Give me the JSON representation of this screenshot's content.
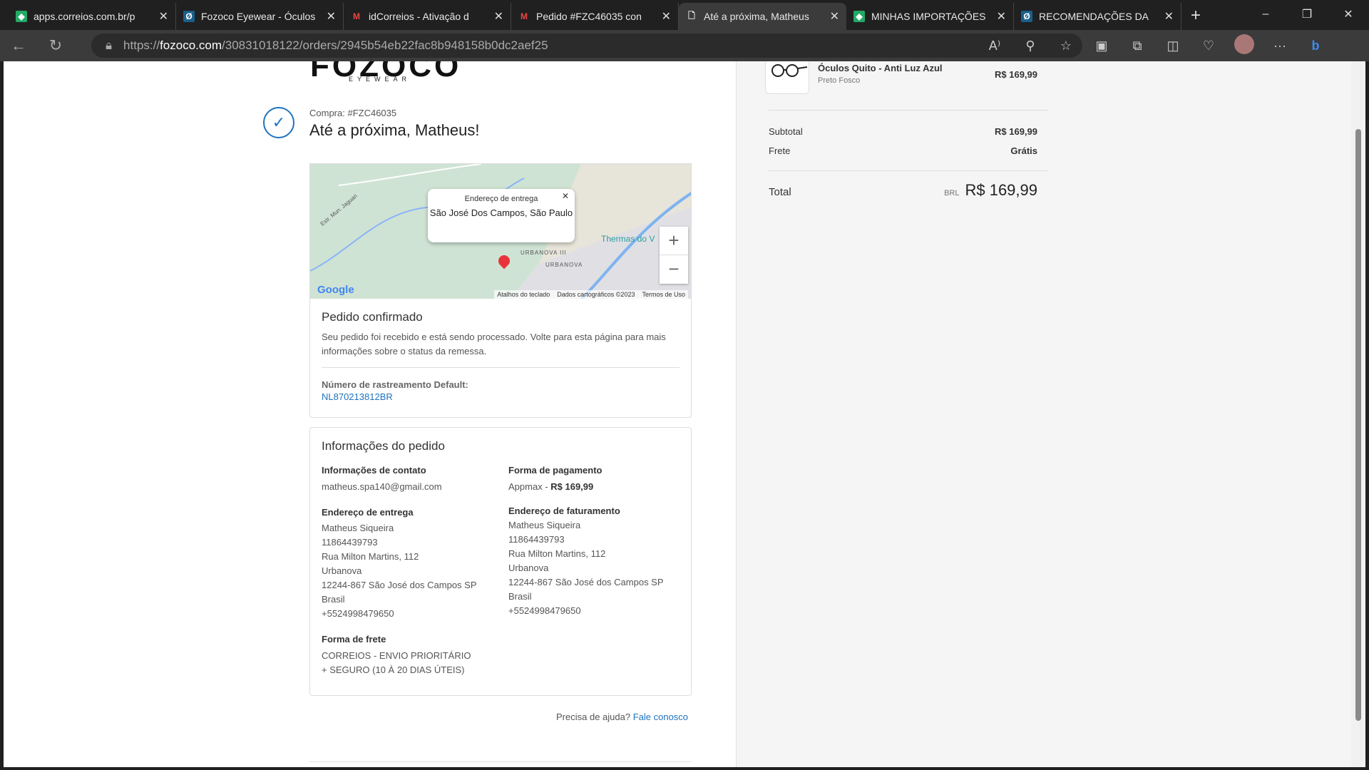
{
  "browser": {
    "tabs": [
      {
        "title": "apps.correios.com.br/p",
        "icon": "correios-icon"
      },
      {
        "title": "Fozoco Eyewear - Óculos",
        "icon": "fozoco-icon"
      },
      {
        "title": "idCorreios - Ativação d",
        "icon": "gmail-icon"
      },
      {
        "title": "Pedido #FZC46035 con",
        "icon": "gmail-icon"
      },
      {
        "title": "Até a próxima, Matheus",
        "icon": "page-icon",
        "active": true
      },
      {
        "title": "MINHAS IMPORTAÇÕES",
        "icon": "correios-icon"
      },
      {
        "title": "RECOMENDAÇÕES DA",
        "icon": "fozoco-icon"
      }
    ],
    "url_prefix": "https://",
    "url_host": "fozoco.com",
    "url_path": "/30831018122/orders/2945b54eb22fac8b948158b0dc2aef25"
  },
  "header": {
    "logo": "FOZOCO",
    "logo_sub": "EYEWEAR",
    "order_label": "Compra: #FZC46035",
    "title": "Até a próxima, Matheus!"
  },
  "map": {
    "popup_label": "Endereço de entrega",
    "popup_value": "São José Dos Campos, São Paulo",
    "labels": [
      "URBANOVA III",
      "URBANOVA",
      "Thermas do V",
      "Estr. Mun. Jaguari"
    ],
    "google": "Google",
    "attribution": [
      "Atalhos do teclado",
      "Dados cartográficos ©2023",
      "Termos de Uso"
    ]
  },
  "confirmed": {
    "title": "Pedido confirmado",
    "message": "Seu pedido foi recebido e está sendo processado. Volte para esta página para mais informações sobre o status da remessa.",
    "tracking_label": "Número de rastreamento Default:",
    "tracking_number": "NL870213812BR"
  },
  "info": {
    "title": "Informações do pedido",
    "contact_label": "Informações de contato",
    "contact_email": "matheus.spa140@gmail.com",
    "payment_label": "Forma de pagamento",
    "payment_method": "Appmax",
    "payment_amount": "R$ 169,99",
    "shipping_label": "Endereço de entrega",
    "shipping_lines": [
      "Matheus Siqueira",
      "11864439793",
      "Rua Milton Martins, 112",
      "Urbanova",
      "12244-867 São José dos Campos SP",
      "Brasil",
      "+5524998479650"
    ],
    "billing_label": "Endereço de faturamento",
    "billing_lines": [
      "Matheus Siqueira",
      "11864439793",
      "Rua Milton Martins, 112",
      "Urbanova",
      "12244-867 São José dos Campos SP",
      "Brasil",
      "+5524998479650"
    ],
    "freight_label": "Forma de frete",
    "freight_value": "CORREIOS - ENVIO PRIORITÁRIO + SEGURO (10 À 20 DIAS ÚTEIS)"
  },
  "help": {
    "text": "Precisa de ajuda?",
    "link": "Fale conosco"
  },
  "summary": {
    "product_name": "Óculos Quito - Anti Luz Azul",
    "product_variant": "Preto Fosco",
    "product_price": "R$ 169,99",
    "subtotal_label": "Subtotal",
    "subtotal": "R$ 169,99",
    "shipping_label": "Frete",
    "shipping": "Grátis",
    "total_label": "Total",
    "currency": "BRL",
    "total": "R$ 169,99"
  }
}
